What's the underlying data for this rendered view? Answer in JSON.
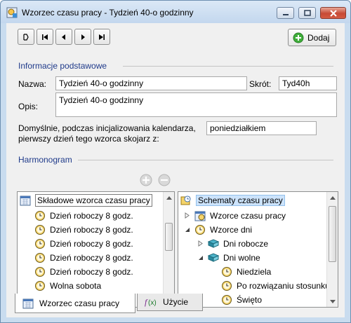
{
  "window": {
    "title": "Wzorzec czasu pracy - Tydzień 40-o godzinny"
  },
  "toolbar": {
    "nav_buttons": [
      "first",
      "prev",
      "next",
      "last"
    ],
    "add_label": "Dodaj"
  },
  "basic": {
    "section_title": "Informacje podstawowe",
    "name_label": "Nazwa:",
    "name_value": "Tydzień 40-o godzinny",
    "short_label": "Skrót:",
    "short_value": "Tyd40h",
    "desc_label": "Opis:",
    "desc_value": "Tydzień 40-o godzinny",
    "first_day_label_line1": "Domyślnie, podczas inicjalizowania kalendarza,",
    "first_day_label_line2": "pierwszy dzień tego wzorca skojarz z:",
    "first_day_value": "poniedziałkiem"
  },
  "schedule": {
    "section_title": "Harmonogram",
    "left_tree": {
      "header": "Składowe wzorca czasu pracy",
      "items": [
        "Dzień roboczy 8 godz.",
        "Dzień roboczy 8 godz.",
        "Dzień roboczy 8 godz.",
        "Dzień roboczy 8 godz.",
        "Dzień roboczy 8 godz.",
        "Wolna sobota"
      ]
    },
    "right_tree": {
      "root": "Schematy czasu pracy",
      "items": [
        {
          "label": "Wzorce czasu pracy",
          "level": 1,
          "expander": "collapsed",
          "icon": "pattern-icon"
        },
        {
          "label": "Wzorce dni",
          "level": 1,
          "expander": "expanded",
          "icon": "clock-icon"
        },
        {
          "label": "Dni robocze",
          "level": 2,
          "expander": "collapsed",
          "icon": "book-icon"
        },
        {
          "label": "Dni wolne",
          "level": 2,
          "expander": "expanded",
          "icon": "book-icon"
        },
        {
          "label": "Niedziela",
          "level": 3,
          "expander": "none",
          "icon": "clock-icon"
        },
        {
          "label": "Po rozwiązaniu stosunku",
          "level": 3,
          "expander": "none",
          "icon": "clock-icon"
        },
        {
          "label": "Święto",
          "level": 3,
          "expander": "none",
          "icon": "clock-icon"
        }
      ]
    }
  },
  "tabs": [
    {
      "label": "Wzorzec czasu pracy",
      "active": true
    },
    {
      "label": "Użycie",
      "active": false
    }
  ]
}
